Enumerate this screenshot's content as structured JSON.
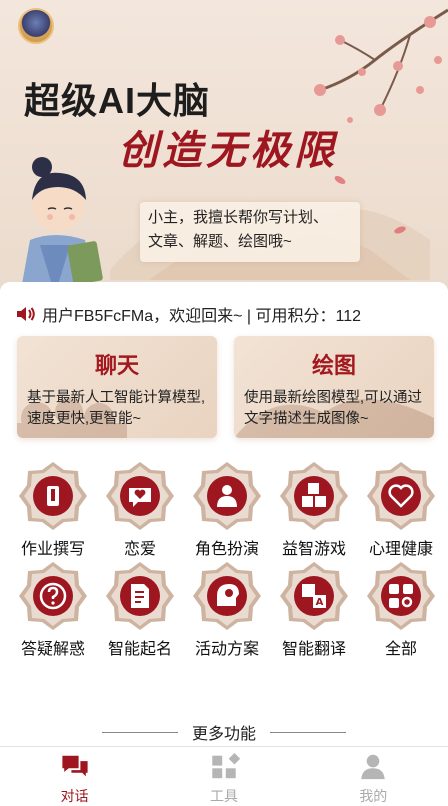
{
  "colors": {
    "accent": "#9e1620",
    "badge_inner": "#9e1620",
    "badge_outer": "#cdb3a0",
    "tab_inactive": "#aaaaaa"
  },
  "hero": {
    "title": "超级AI大脑",
    "subtitle": "创造无极限",
    "speech_line1": "小主，我擅长帮你写计划、",
    "speech_line2": "文章、解题、绘图哦~"
  },
  "notice": {
    "text": "用户FB5FcFMa，欢迎回来~ | 可用积分：112"
  },
  "cards": [
    {
      "title": "聊天",
      "desc": "基于最新人工智能计算模型,速度更快,更智能~"
    },
    {
      "title": "绘图",
      "desc": "使用最新绘图模型,可以通过文字描述生成图像~"
    }
  ],
  "grid": [
    {
      "label": "作业撰写",
      "icon": "pencil-icon"
    },
    {
      "label": "恋爱",
      "icon": "heart-chat-icon"
    },
    {
      "label": "角色扮演",
      "icon": "person-icon"
    },
    {
      "label": "益智游戏",
      "icon": "abc-blocks-icon"
    },
    {
      "label": "心理健康",
      "icon": "heart-outline-icon"
    },
    {
      "label": "答疑解惑",
      "icon": "question-icon"
    },
    {
      "label": "智能起名",
      "icon": "document-edit-icon"
    },
    {
      "label": "活动方案",
      "icon": "lightbulb-head-icon"
    },
    {
      "label": "智能翻译",
      "icon": "translate-icon"
    },
    {
      "label": "全部",
      "icon": "apps-search-icon"
    }
  ],
  "more_label": "更多功能",
  "tabs": [
    {
      "label": "对话",
      "icon": "chat-icon",
      "active": true
    },
    {
      "label": "工具",
      "icon": "tools-icon",
      "active": false
    },
    {
      "label": "我的",
      "icon": "user-icon",
      "active": false
    }
  ]
}
